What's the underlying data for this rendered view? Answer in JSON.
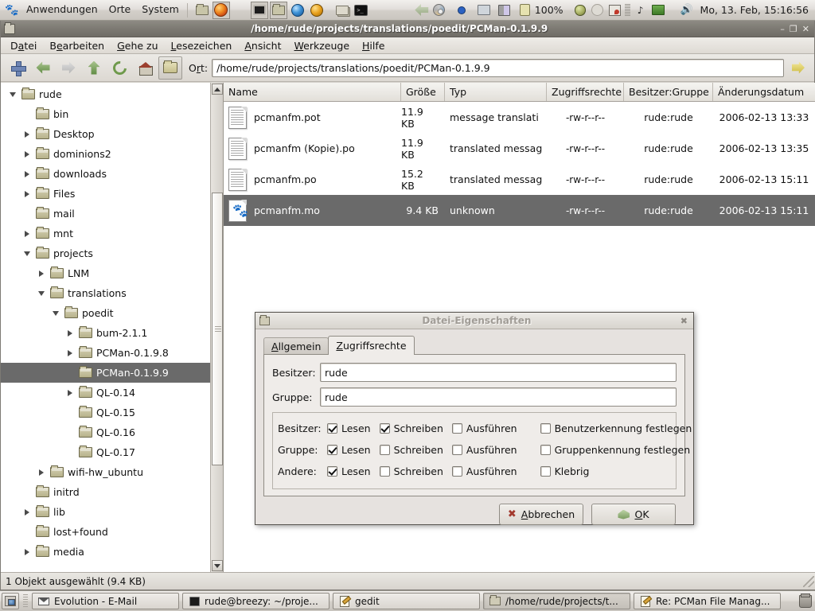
{
  "panel": {
    "foot_icon": "gnome-foot-icon",
    "menus": [
      "Anwendungen",
      "Orte",
      "System"
    ],
    "launchers": [
      "folder-icon",
      "firefox-icon",
      "terminal-icon",
      "file-manager-icon",
      "globe-icon",
      "gears-icon",
      "files-icon",
      "black-terminal-icon"
    ],
    "tray": [
      "cd-drive-icon",
      "blue-dot-icon",
      "network-icon",
      "memory-icon",
      "power-plug-icon"
    ],
    "battery": "100%",
    "tray2": [
      "apple-icon",
      "clock-gray-icon",
      "cards-icon",
      "bars-icon",
      "note-icon",
      "laptop-icon"
    ],
    "volume_icon": "speaker-icon",
    "clock": "Mo, 13. Feb, 15:16:56"
  },
  "window": {
    "title": "/home/rude/projects/translations/poedit/PCMan-0.1.9.9",
    "buttons": {
      "minimize": "–",
      "maximize": "❐",
      "close": "✕"
    },
    "menubar": [
      {
        "pre": "D",
        "key": "a",
        "post": "tei"
      },
      {
        "pre": "B",
        "key": "e",
        "post": "arbeiten"
      },
      {
        "pre": "",
        "key": "G",
        "post": "ehe zu"
      },
      {
        "pre": "",
        "key": "L",
        "post": "esezeichen"
      },
      {
        "pre": "",
        "key": "A",
        "post": "nsicht"
      },
      {
        "pre": "",
        "key": "W",
        "post": "erkzeuge"
      },
      {
        "pre": "",
        "key": "H",
        "post": "ilfe"
      }
    ],
    "toolbar": {
      "buttons": [
        "new-tab-icon",
        "back-icon",
        "forward-icon",
        "up-icon",
        "reload-icon",
        "home-icon",
        "open-folder-icon"
      ],
      "location_label_pre": "O",
      "location_label_key": "r",
      "location_label_post": "t:",
      "location_value": "/home/rude/projects/translations/poedit/PCMan-0.1.9.9",
      "go_icon": "go-arrow-icon"
    },
    "statusbar": "1 Objekt ausgewählt (9.4 KB)"
  },
  "sidebar": {
    "items": [
      {
        "label": "rude",
        "indent": 1,
        "twisty": "open"
      },
      {
        "label": "bin",
        "indent": 2,
        "twisty": "none"
      },
      {
        "label": "Desktop",
        "indent": 2,
        "twisty": "closed"
      },
      {
        "label": "dominions2",
        "indent": 2,
        "twisty": "closed"
      },
      {
        "label": "downloads",
        "indent": 2,
        "twisty": "closed"
      },
      {
        "label": "Files",
        "indent": 2,
        "twisty": "closed"
      },
      {
        "label": "mail",
        "indent": 2,
        "twisty": "none"
      },
      {
        "label": "mnt",
        "indent": 2,
        "twisty": "closed"
      },
      {
        "label": "projects",
        "indent": 2,
        "twisty": "open"
      },
      {
        "label": "LNM",
        "indent": 3,
        "twisty": "closed"
      },
      {
        "label": "translations",
        "indent": 3,
        "twisty": "open"
      },
      {
        "label": "poedit",
        "indent": 4,
        "twisty": "open"
      },
      {
        "label": "bum-2.1.1",
        "indent": 5,
        "twisty": "closed"
      },
      {
        "label": "PCMan-0.1.9.8",
        "indent": 5,
        "twisty": "closed"
      },
      {
        "label": "PCMan-0.1.9.9",
        "indent": 5,
        "twisty": "none",
        "selected": true
      },
      {
        "label": "QL-0.14",
        "indent": 5,
        "twisty": "closed"
      },
      {
        "label": "QL-0.15",
        "indent": 5,
        "twisty": "none"
      },
      {
        "label": "QL-0.16",
        "indent": 5,
        "twisty": "none"
      },
      {
        "label": "QL-0.17",
        "indent": 5,
        "twisty": "none"
      },
      {
        "label": "wifi-hw_ubuntu",
        "indent": 3,
        "twisty": "closed"
      },
      {
        "label": "initrd",
        "indent": 2,
        "twisty": "none"
      },
      {
        "label": "lib",
        "indent": 2,
        "twisty": "closed"
      },
      {
        "label": "lost+found",
        "indent": 2,
        "twisty": "none"
      },
      {
        "label": "media",
        "indent": 2,
        "twisty": "closed"
      }
    ]
  },
  "filelist": {
    "columns": [
      "Name",
      "Größe",
      "Typ",
      "Zugriffsrechte",
      "Besitzer:Gruppe",
      "Änderungsdatum"
    ],
    "rows": [
      {
        "icon": "text-document-icon",
        "name": "pcmanfm.pot",
        "size": "11.9 KB",
        "type": "message translati",
        "perms": "-rw-r--r--",
        "owner": "rude:rude",
        "date": "2006-02-13 13:33",
        "selected": false
      },
      {
        "icon": "text-document-icon",
        "name": "pcmanfm (Kopie).po",
        "size": "11.9 KB",
        "type": "translated messag",
        "perms": "-rw-r--r--",
        "owner": "rude:rude",
        "date": "2006-02-13 13:35",
        "selected": false
      },
      {
        "icon": "text-document-icon",
        "name": "pcmanfm.po",
        "size": "15.2 KB",
        "type": "translated messag",
        "perms": "-rw-r--r--",
        "owner": "rude:rude",
        "date": "2006-02-13 15:11",
        "selected": false
      },
      {
        "icon": "gnome-mo-file-icon",
        "name": "pcmanfm.mo",
        "size": "9.4 KB",
        "type": "unknown",
        "perms": "-rw-r--r--",
        "owner": "rude:rude",
        "date": "2006-02-13 15:11",
        "selected": true
      }
    ]
  },
  "dialog": {
    "title": "Datei-Eigenschaften",
    "close_icon": "✖",
    "tabs": [
      {
        "pre": "",
        "key": "A",
        "post": "llgemein",
        "active": false
      },
      {
        "pre": "",
        "key": "Z",
        "post": "ugriffsrechte",
        "active": true
      }
    ],
    "owner_label": "Besitzer:",
    "owner_value": "rude",
    "group_label": "Gruppe:",
    "group_value": "rude",
    "perm_rows": [
      {
        "who": "Besitzer:",
        "read_label": "Lesen",
        "read": true,
        "write_label": "Schreiben",
        "write": true,
        "exec_label": "Ausführen",
        "exec": false
      },
      {
        "who": "Gruppe:",
        "read_label": "Lesen",
        "read": true,
        "write_label": "Schreiben",
        "write": false,
        "exec_label": "Ausführen",
        "exec": false
      },
      {
        "who": "Andere:",
        "read_label": "Lesen",
        "read": true,
        "write_label": "Schreiben",
        "write": false,
        "exec_label": "Ausführen",
        "exec": false
      }
    ],
    "special": [
      {
        "label": "Benutzerkennung festlegen",
        "checked": false
      },
      {
        "label": "Gruppenkennung festlegen",
        "checked": false
      },
      {
        "label": "Klebrig",
        "checked": false
      }
    ],
    "cancel": {
      "pre": "",
      "key": "A",
      "post": "bbrechen"
    },
    "ok": {
      "pre": "",
      "key": "O",
      "post": "K"
    }
  },
  "taskbar": {
    "show_desktop": "show-desktop-icon",
    "tasks": [
      {
        "icon": "mail-icon",
        "label": "Evolution - E-Mail",
        "active": false
      },
      {
        "icon": "terminal-icon",
        "label": "rude@breezy: ~/proje...",
        "active": false
      },
      {
        "icon": "gedit-icon",
        "label": "gedit",
        "active": false
      },
      {
        "icon": "folder-icon",
        "label": "/home/rude/projects/t...",
        "active": true
      },
      {
        "icon": "gedit-icon",
        "label": "Re: PCMan File Manag...",
        "active": false
      }
    ],
    "trash": "trash-icon"
  }
}
